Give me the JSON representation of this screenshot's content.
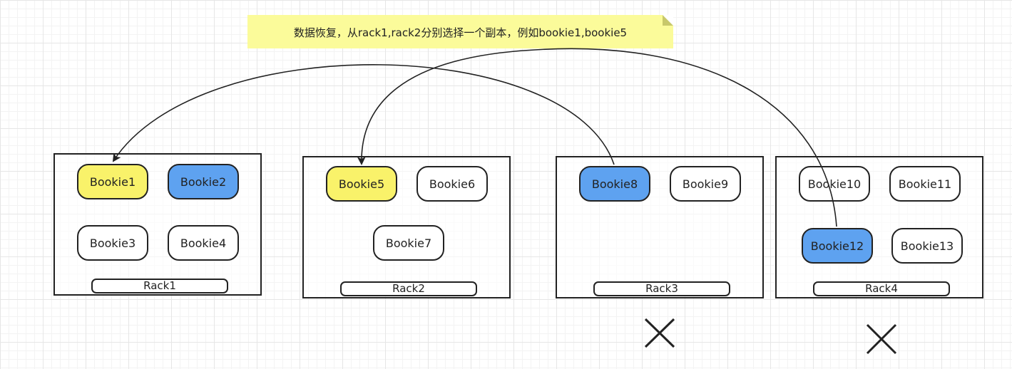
{
  "note": {
    "text": "数据恢复，从rack1,rack2分别选择一个副本，例如bookie1,bookie5"
  },
  "racks": [
    {
      "label": "Rack1",
      "bookies": [
        {
          "label": "Bookie1",
          "color": "#f9f26a"
        },
        {
          "label": "Bookie2",
          "color": "#5ea2f0"
        },
        {
          "label": "Bookie3",
          "color": "#ffffff"
        },
        {
          "label": "Bookie4",
          "color": "#ffffff"
        }
      ]
    },
    {
      "label": "Rack2",
      "bookies": [
        {
          "label": "Bookie5",
          "color": "#f9f26a"
        },
        {
          "label": "Bookie6",
          "color": "#ffffff"
        },
        {
          "label": "Bookie7",
          "color": "#ffffff"
        }
      ]
    },
    {
      "label": "Rack3",
      "failed": true,
      "bookies": [
        {
          "label": "Bookie8",
          "color": "#5ea2f0"
        },
        {
          "label": "Bookie9",
          "color": "#ffffff"
        }
      ]
    },
    {
      "label": "Rack4",
      "failed": true,
      "bookies": [
        {
          "label": "Bookie10",
          "color": "#ffffff"
        },
        {
          "label": "Bookie11",
          "color": "#ffffff"
        },
        {
          "label": "Bookie12",
          "color": "#5ea2f0"
        },
        {
          "label": "Bookie13",
          "color": "#ffffff"
        }
      ]
    }
  ],
  "edges": [
    {
      "from": "Bookie8",
      "to": "Bookie1"
    },
    {
      "from": "Bookie12",
      "to": "Bookie5"
    }
  ],
  "colors": {
    "selected": "#f9f26a",
    "source": "#5ea2f0",
    "note_bg": "#fbfb9a"
  }
}
